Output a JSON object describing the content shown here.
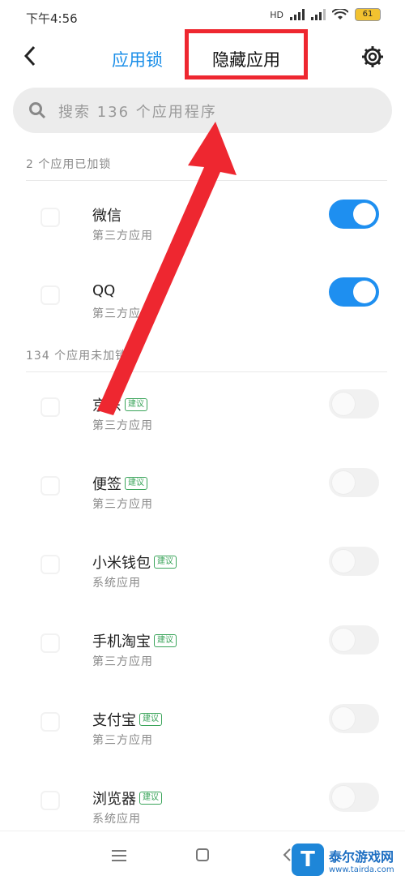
{
  "status_bar": {
    "time": "下午4:56",
    "hd": "HD",
    "battery": "61"
  },
  "header": {
    "tab_app_lock": "应用锁",
    "tab_hidden_apps": "隐藏应用"
  },
  "search": {
    "placeholder": "搜索 136 个应用程序"
  },
  "locked_section": {
    "title": "2 个应用已加锁",
    "items": [
      {
        "name": "微信",
        "subtitle": "第三方应用",
        "enabled": true
      },
      {
        "name": "QQ",
        "subtitle": "第三方应用",
        "enabled": true
      }
    ]
  },
  "unlocked_section": {
    "title": "134 个应用未加锁",
    "items": [
      {
        "name": "京东",
        "tag": "建议",
        "subtitle": "第三方应用",
        "enabled": false
      },
      {
        "name": "便签",
        "tag": "建议",
        "subtitle": "第三方应用",
        "enabled": false
      },
      {
        "name": "小米钱包",
        "tag": "建议",
        "subtitle": "系统应用",
        "enabled": false
      },
      {
        "name": "手机淘宝",
        "tag": "建议",
        "subtitle": "第三方应用",
        "enabled": false
      },
      {
        "name": "支付宝",
        "tag": "建议",
        "subtitle": "第三方应用",
        "enabled": false
      },
      {
        "name": "浏览器",
        "tag": "建议",
        "subtitle": "系统应用",
        "enabled": false
      }
    ]
  },
  "watermark": {
    "line1": "泰尔游戏网",
    "line2": "www.tairda.com",
    "logo": "T"
  },
  "colors": {
    "accent": "#1e8ff0",
    "annotation_red": "#ee2730",
    "tag_green": "#3aa45a"
  }
}
